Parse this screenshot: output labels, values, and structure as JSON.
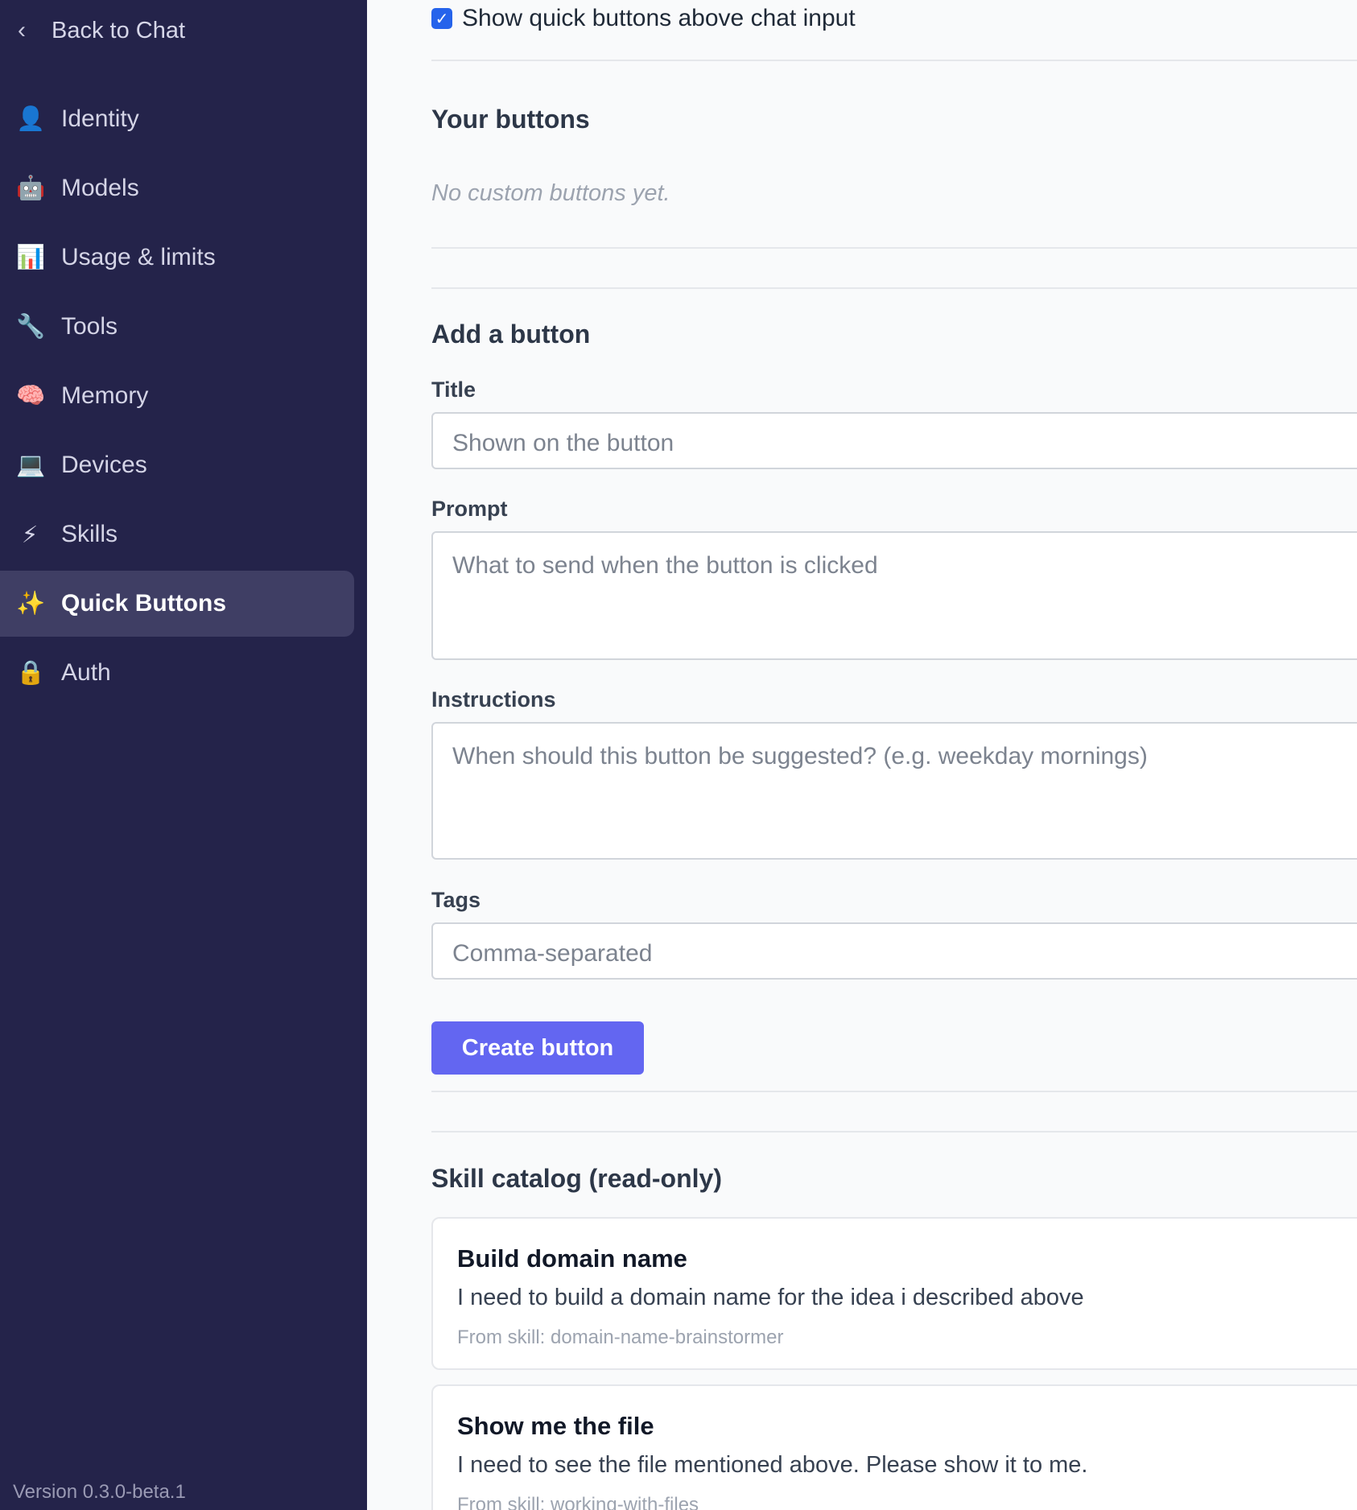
{
  "sidebar": {
    "back_label": "Back to Chat",
    "items": [
      {
        "icon": "👤",
        "icon_name": "user-icon",
        "label": "Identity"
      },
      {
        "icon": "🤖",
        "icon_name": "robot-icon",
        "label": "Models"
      },
      {
        "icon": "📊",
        "icon_name": "bar-chart-icon",
        "label": "Usage & limits"
      },
      {
        "icon": "🔧",
        "icon_name": "wrench-icon",
        "label": "Tools"
      },
      {
        "icon": "🧠",
        "icon_name": "brain-icon",
        "label": "Memory"
      },
      {
        "icon": "💻",
        "icon_name": "laptop-icon",
        "label": "Devices"
      },
      {
        "icon": "⚡",
        "icon_name": "lightning-icon",
        "label": "Skills"
      },
      {
        "icon": "✨",
        "icon_name": "sparkles-icon",
        "label": "Quick Buttons"
      },
      {
        "icon": "🔒",
        "icon_name": "lock-icon",
        "label": "Auth"
      }
    ],
    "active_item": "Quick Buttons",
    "version": "Version 0.3.0-beta.1"
  },
  "settings": {
    "show_quick_buttons_label": "Show quick buttons above chat input",
    "show_quick_buttons_checked": true
  },
  "your_buttons": {
    "heading": "Your buttons",
    "empty_text": "No custom buttons yet."
  },
  "add_button": {
    "heading": "Add a button",
    "title_label": "Title",
    "title_placeholder": "Shown on the button",
    "prompt_label": "Prompt",
    "prompt_placeholder": "What to send when the button is clicked",
    "instructions_label": "Instructions",
    "instructions_placeholder": "When should this button be suggested? (e.g. weekday mornings)",
    "tags_label": "Tags",
    "tags_placeholder": "Comma-separated",
    "submit_label": "Create button"
  },
  "skill_catalog": {
    "heading": "Skill catalog (read-only)",
    "items": [
      {
        "title": "Build domain name",
        "prompt": "I need to build a domain name for the idea i described above",
        "source": "From skill: domain-name-brainstormer"
      },
      {
        "title": "Show me the file",
        "prompt": "I need to see the file mentioned above. Please show it to me.",
        "source": "From skill: working-with-files"
      }
    ]
  },
  "colors": {
    "sidebar_bg": "#24234a",
    "sidebar_active_bg": "#3f3e64",
    "accent": "#6366f1",
    "checkbox": "#2563eb"
  }
}
